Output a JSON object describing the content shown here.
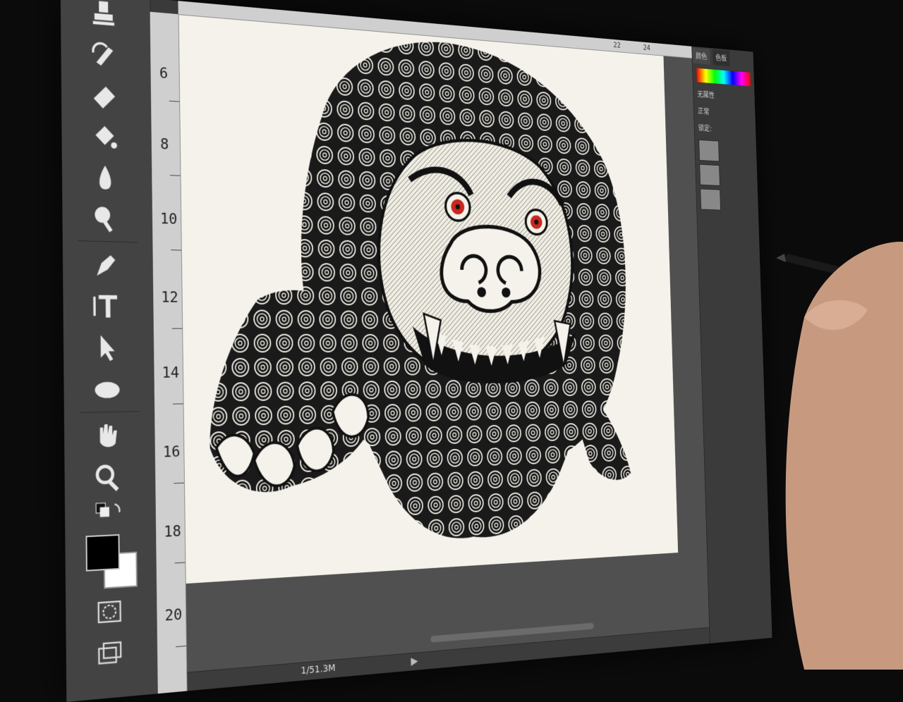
{
  "app": {
    "name": "Photoshop"
  },
  "ruler": {
    "vertical_labels": [
      "6",
      "8",
      "10",
      "12",
      "14",
      "16",
      "18",
      "20"
    ],
    "horizontal_labels": [
      "22",
      "24"
    ]
  },
  "tools": [
    {
      "name": "stamp-tool-icon"
    },
    {
      "name": "history-brush-tool-icon"
    },
    {
      "name": "eraser-tool-icon"
    },
    {
      "name": "paint-bucket-tool-icon"
    },
    {
      "name": "blur-tool-icon"
    },
    {
      "name": "dodge-tool-icon"
    },
    {
      "name": "pen-tool-icon"
    },
    {
      "name": "type-tool-icon"
    },
    {
      "name": "path-selection-tool-icon"
    },
    {
      "name": "ellipse-tool-icon"
    },
    {
      "name": "hand-tool-icon"
    },
    {
      "name": "zoom-tool-icon"
    }
  ],
  "colors": {
    "foreground": "#000000",
    "background": "#ffffff",
    "eye_red": "#c8281e"
  },
  "status": {
    "doc_size": "1/51.3M"
  },
  "panels": {
    "tabs": [
      "颜色",
      "色板"
    ],
    "prop_row": "无属性",
    "blend_mode": "正常",
    "lock_label": "锁定:"
  },
  "artwork": {
    "subject": "foo-dog-lion-illustration"
  }
}
